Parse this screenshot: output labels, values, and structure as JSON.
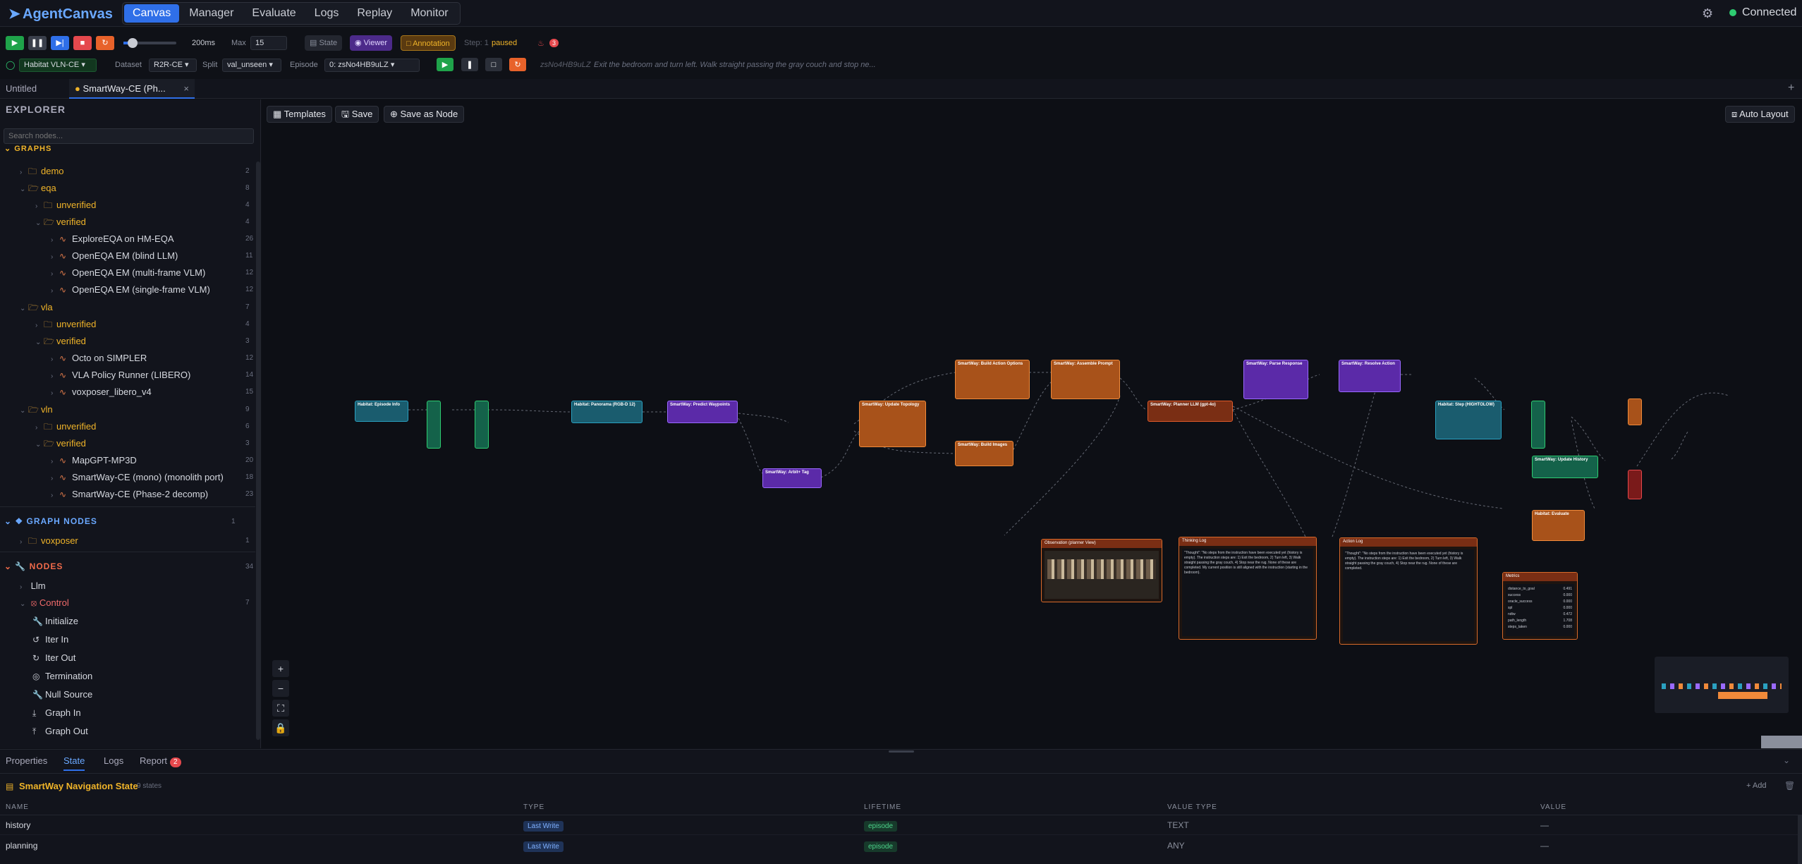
{
  "app": {
    "name": "AgentCanvas",
    "nav_tabs": [
      "Canvas",
      "Manager",
      "Evaluate",
      "Logs",
      "Replay",
      "Monitor"
    ],
    "connection_status": "Connected"
  },
  "toolbar": {
    "speed": "200ms",
    "max_label": "Max",
    "max_value": "15",
    "state_label": "State",
    "viewer_label": "Viewer",
    "annotation_label": "Annotation",
    "step_label": "Step: 1",
    "status": "paused",
    "alert_count": "3"
  },
  "toolbar2": {
    "env": "Habitat VLN-CE",
    "dataset_label": "Dataset",
    "dataset": "R2R-CE",
    "split_label": "Split",
    "split": "val_unseen",
    "episode_label": "Episode",
    "episode": "0: zsNo4HB9uLZ",
    "episode_id": "zsNo4HB9uLZ",
    "instruction": "Exit the bedroom and turn left. Walk straight passing the gray couch and stop ne..."
  },
  "doc_tabs": [
    "Untitled",
    "SmartWay-CE (Ph..."
  ],
  "explorer": {
    "title": "EXPLORER",
    "search_placeholder": "Search nodes...",
    "graphs_header": "GRAPHS",
    "tree": [
      {
        "label": "demo",
        "count": "2"
      },
      {
        "label": "eqa",
        "count": "8"
      },
      {
        "label": "unverified",
        "count": "4"
      },
      {
        "label": "verified",
        "count": "4"
      },
      {
        "label": "ExploreEQA on HM-EQA",
        "count": "26"
      },
      {
        "label": "OpenEQA EM (blind LLM)",
        "count": "11"
      },
      {
        "label": "OpenEQA EM (multi-frame VLM)",
        "count": "12"
      },
      {
        "label": "OpenEQA EM (single-frame VLM)",
        "count": "12"
      },
      {
        "label": "vla",
        "count": "7"
      },
      {
        "label": "unverified",
        "count": "4"
      },
      {
        "label": "verified",
        "count": "3"
      },
      {
        "label": "Octo on SIMPLER",
        "count": "12"
      },
      {
        "label": "VLA Policy Runner (LIBERO)",
        "count": "14"
      },
      {
        "label": "voxposer_libero_v4",
        "count": "15"
      },
      {
        "label": "vln",
        "count": "9"
      },
      {
        "label": "unverified",
        "count": "6"
      },
      {
        "label": "verified",
        "count": "3"
      },
      {
        "label": "MapGPT-MP3D",
        "count": "20"
      },
      {
        "label": "SmartWay-CE (mono) (monolith port)",
        "count": "18"
      },
      {
        "label": "SmartWay-CE (Phase-2 decomp)",
        "count": "23"
      }
    ],
    "graph_nodes_header": "GRAPH NODES",
    "graph_nodes_count": "1",
    "graph_nodes": [
      {
        "label": "voxposer",
        "count": "1"
      }
    ],
    "nodes_header": "NODES",
    "nodes_count": "34",
    "nodes": [
      "Llm",
      "Control",
      "Initialize",
      "Iter In",
      "Iter Out",
      "Termination",
      "Null Source",
      "Graph In",
      "Graph Out"
    ],
    "control_count": "7"
  },
  "canvas": {
    "templates_label": "Templates",
    "save_label": "Save",
    "save_as_node_label": "Save as Node",
    "auto_layout_label": "Auto Layout",
    "nodes": [
      {
        "label": "Habitat: Episode Info",
        "color": "#1a5c6e"
      },
      {
        "label": "Habitat: Panorama (RGB-D 12)",
        "color": "#1a5c6e"
      },
      {
        "label": "SmartWay: Predict Waypoints",
        "color": "#5b2aa8"
      },
      {
        "label": "SmartWay: Arbit+ Tag",
        "color": "#5b2aa8"
      },
      {
        "label": "SmartWay: Update Topology",
        "color": "#a8521a"
      },
      {
        "label": "SmartWay: Build Action Options",
        "color": "#a8521a"
      },
      {
        "label": "SmartWay: Build Images",
        "color": "#a8521a"
      },
      {
        "label": "SmartWay: Assemble Prompt",
        "color": "#a8521a"
      },
      {
        "label": "SmartWay: Planner LLM (gpt-4o)",
        "color": "#7a2e14"
      },
      {
        "label": "SmartWay: Parse Response",
        "color": "#5b2aa8"
      },
      {
        "label": "SmartWay: Resolve Action",
        "color": "#5b2aa8"
      },
      {
        "label": "Habitat: Step (HIGHTOLOW)",
        "color": "#1a5c6e"
      },
      {
        "label": "SmartWay: Update History",
        "color": "#14624a"
      },
      {
        "label": "Habitat: Evaluate",
        "color": "#a8521a"
      }
    ],
    "observation_title": "Observation (planner View)",
    "thinking_title": "Thinking Log",
    "thinking_text": "\"Thought\": \"No steps from the instruction have been executed yet (history is empty). The instruction steps are: 1) Exit the bedroom, 2) Turn left, 3) Walk straight passing the gray couch, 4) Stop near the rug. None of these are completed. My current position is still aligned with the instruction (starting in the bedroom).",
    "action_title": "Action Log",
    "action_text": "\"Thought\": \"No steps from the instruction have been executed yet (history is empty). The instruction steps are: 1) Exit the bedroom, 2) Turn left, 3) Walk straight passing the gray couch, 4) Stop near the rug. None of these are completed.",
    "metrics_title": "Metrics",
    "metrics": [
      {
        "k": "distance_to_goal",
        "v": "0.491"
      },
      {
        "k": "success",
        "v": "0.000"
      },
      {
        "k": "oracle_success",
        "v": "0.000"
      },
      {
        "k": "spl",
        "v": "0.000"
      },
      {
        "k": "ndtw",
        "v": "0.472"
      },
      {
        "k": "path_length",
        "v": "1.708"
      },
      {
        "k": "steps_taken",
        "v": "0.000"
      }
    ]
  },
  "bottom": {
    "tabs": [
      "Properties",
      "State",
      "Logs",
      "Report"
    ],
    "report_count": "2",
    "title": "SmartWay Navigation State",
    "state_count": "9 states",
    "add_label": "Add",
    "columns": [
      "NAME",
      "TYPE",
      "LIFETIME",
      "VALUE TYPE",
      "VALUE"
    ],
    "rows": [
      {
        "name": "history",
        "type": "Last Write",
        "lifetime": "episode",
        "value_type": "TEXT",
        "value": "—"
      },
      {
        "name": "planning",
        "type": "Last Write",
        "lifetime": "episode",
        "value_type": "ANY",
        "value": "—"
      }
    ]
  },
  "colors": {
    "accent": "#2f6fe8",
    "brand": "#6aa8ff",
    "ok": "#2ecc71"
  }
}
